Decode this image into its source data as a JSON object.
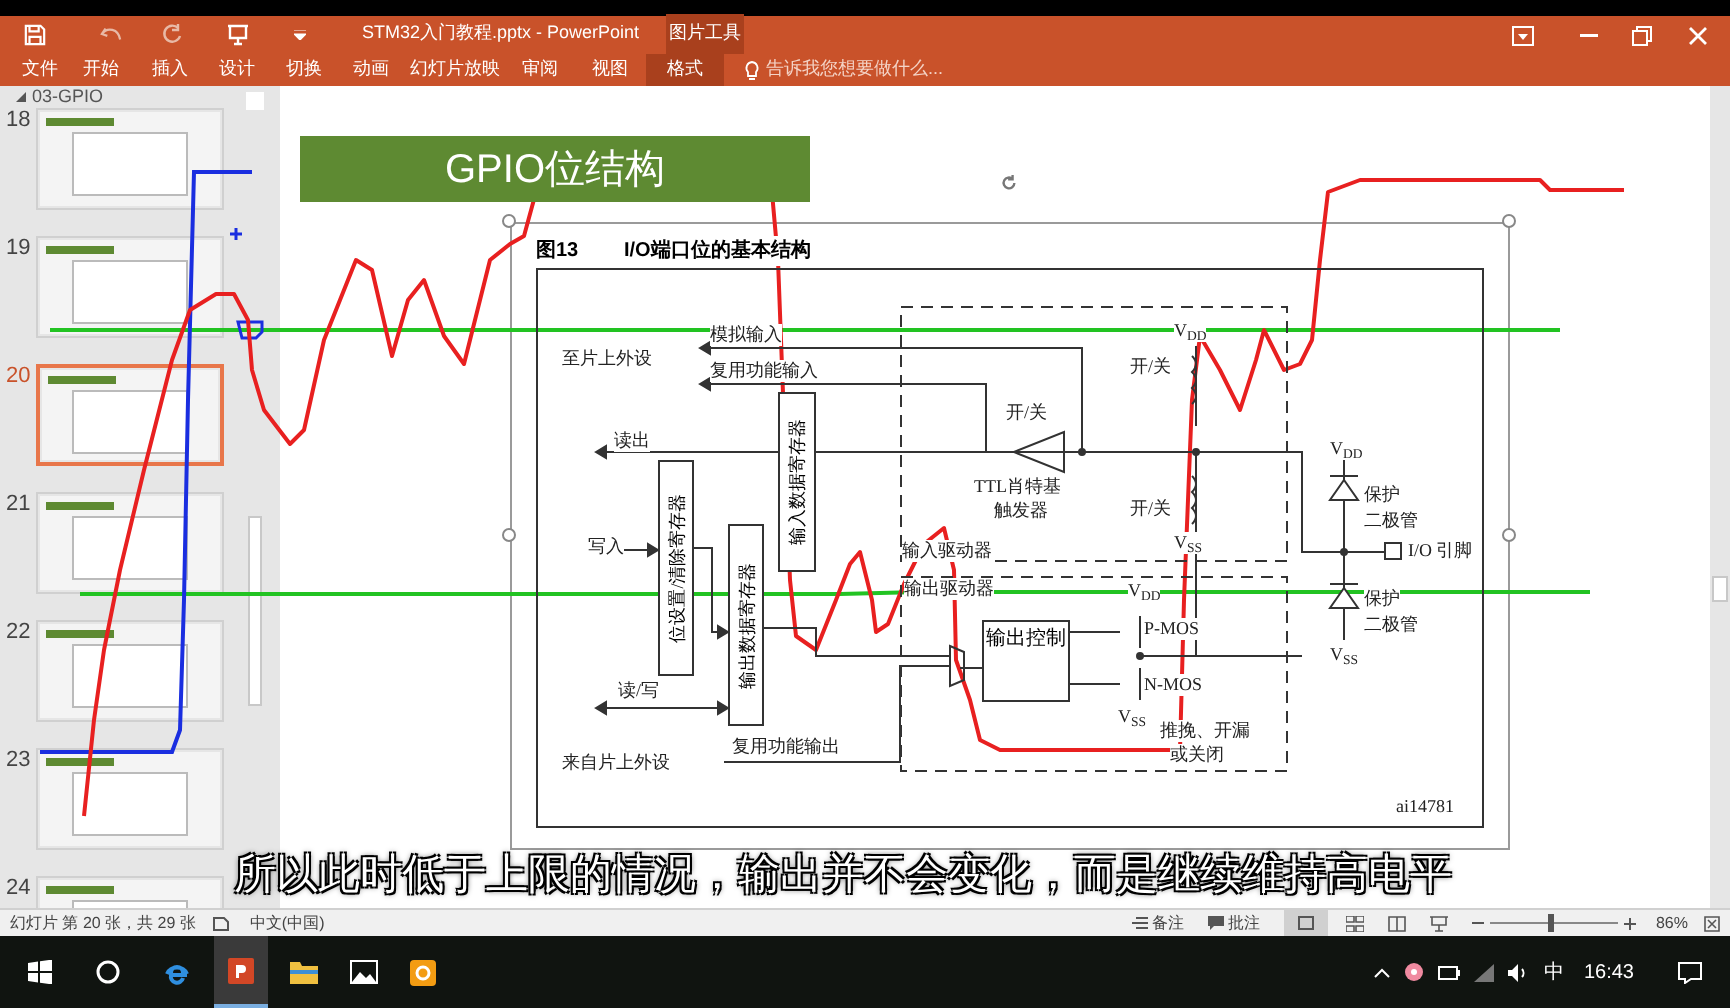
{
  "window": {
    "title": "STM32入门教程.pptx - PowerPoint",
    "context_tab": "图片工具"
  },
  "ribbon_tabs": [
    {
      "label": "文件",
      "selected": false
    },
    {
      "label": "开始",
      "selected": false
    },
    {
      "label": "插入",
      "selected": false
    },
    {
      "label": "设计",
      "selected": false
    },
    {
      "label": "切换",
      "selected": false
    },
    {
      "label": "动画",
      "selected": false
    },
    {
      "label": "幻灯片放映",
      "selected": false
    },
    {
      "label": "审阅",
      "selected": false
    },
    {
      "label": "视图",
      "selected": false
    },
    {
      "label": "格式",
      "selected": true
    }
  ],
  "tell_me": {
    "placeholder": "告诉我您想要做什么..."
  },
  "thumbnails": {
    "section": "03-GPIO",
    "slides": [
      {
        "number": "18",
        "selected": false
      },
      {
        "number": "19",
        "selected": false
      },
      {
        "number": "20",
        "selected": true
      },
      {
        "number": "21",
        "selected": false
      },
      {
        "number": "22",
        "selected": false
      },
      {
        "number": "23",
        "selected": false
      },
      {
        "number": "24",
        "selected": false
      }
    ]
  },
  "slide": {
    "title": "GPIO位结构",
    "figure_number": "图13",
    "figure_caption": "I/O端口位的基本结构",
    "registers": [
      "输入数据寄存器",
      "位设置/清除寄存器",
      "输出数据寄存器"
    ],
    "output_control": "输出控制",
    "labels": [
      "至片上外设",
      "模拟输入",
      "复用功能输入",
      "读出",
      "开/关",
      "TTL肖特基",
      "触发器",
      "写入",
      "读/写",
      "来自片上外设",
      "复用功能输出",
      "输入驱动器",
      "输出驱动器",
      "V$_{DD}$",
      "开/关",
      "开/关",
      "V$_{SS}$",
      "V$_{DD}$",
      "P-MOS",
      "N-MOS",
      "V$_{SS}$",
      "推挽、开漏",
      "或关闭",
      "V$_{DD}$",
      "保护",
      "二极管",
      "I/O 引脚",
      "保护",
      "二极管",
      "V$_{SS}$",
      "ai14781"
    ]
  },
  "subtitle": "所以此时低于上限的情况，输出并不会变化，而是继续维持高电平",
  "status_bar": {
    "slide_info": "幻灯片 第 20 张，共 29 张",
    "language": "中文(中国)",
    "notes": "备注",
    "comments": "批注",
    "zoom": "86%",
    "zoom_slider": {
      "level": 0.47
    }
  },
  "taskbar": {
    "ime": "中",
    "time": "16:43"
  }
}
